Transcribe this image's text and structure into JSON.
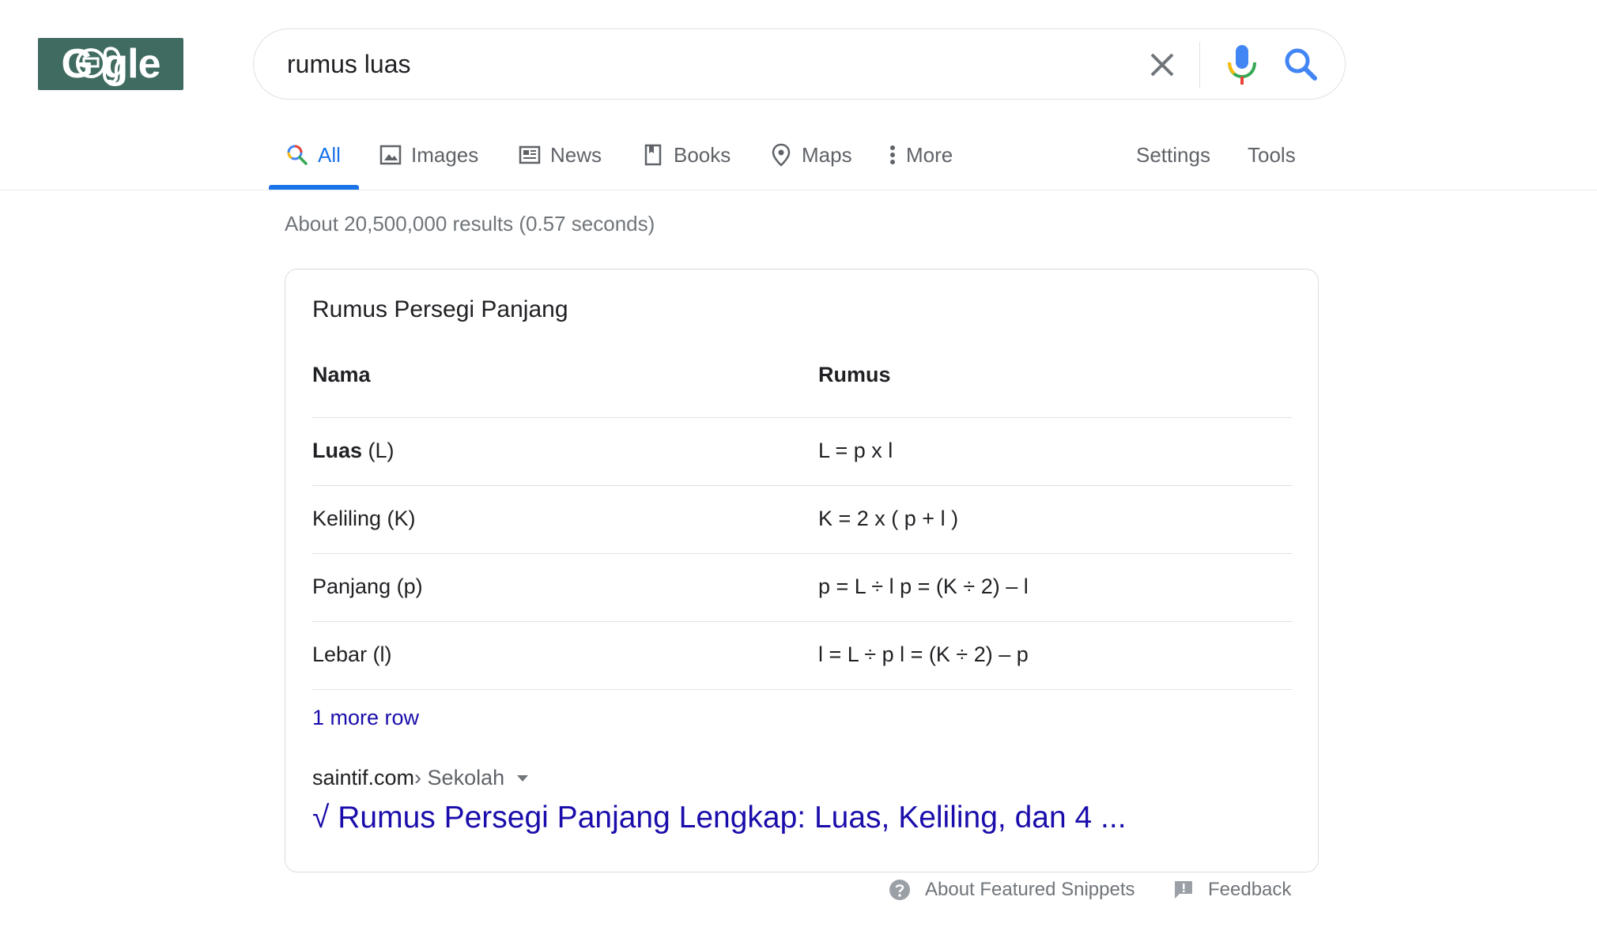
{
  "logo": {
    "text": "G    gle"
  },
  "search": {
    "value": "rumus luas"
  },
  "tabs": [
    {
      "label": "All",
      "icon": "search-icon",
      "active": true
    },
    {
      "label": "Images",
      "icon": "image-icon"
    },
    {
      "label": "News",
      "icon": "news-icon"
    },
    {
      "label": "Books",
      "icon": "book-icon"
    },
    {
      "label": "Maps",
      "icon": "map-pin-icon"
    },
    {
      "label": "More",
      "icon": "vertical-dots-icon"
    }
  ],
  "tools": {
    "settings": "Settings",
    "tools": "Tools"
  },
  "result_stats": "About 20,500,000 results (0.57 seconds)",
  "snippet": {
    "title": "Rumus Persegi Panjang",
    "headers": [
      "Nama",
      "Rumus"
    ],
    "rows": [
      {
        "name_bold": "Luas",
        "name_rest": " (L)",
        "formula": "L = p x l"
      },
      {
        "name_bold": "",
        "name_rest": "Keliling (K)",
        "formula": "K = 2 x ( p + l )"
      },
      {
        "name_bold": "",
        "name_rest": "Panjang (p)",
        "formula": "p = L ÷ l p = (K ÷ 2) – l"
      },
      {
        "name_bold": "",
        "name_rest": "Lebar (l)",
        "formula": "l = L ÷ p l = (K ÷ 2) – p"
      }
    ],
    "more_rows": "1 more row",
    "site": "saintif.com",
    "path": " › Sekolah",
    "link_title": "√ Rumus Persegi Panjang Lengkap: Luas, Keliling, dan 4 ..."
  },
  "footer": {
    "about": "About Featured Snippets",
    "feedback": "Feedback"
  },
  "colors": {
    "link": "#1a0dab",
    "accent": "#1a73e8",
    "logo_bg": "#3f6b61"
  }
}
